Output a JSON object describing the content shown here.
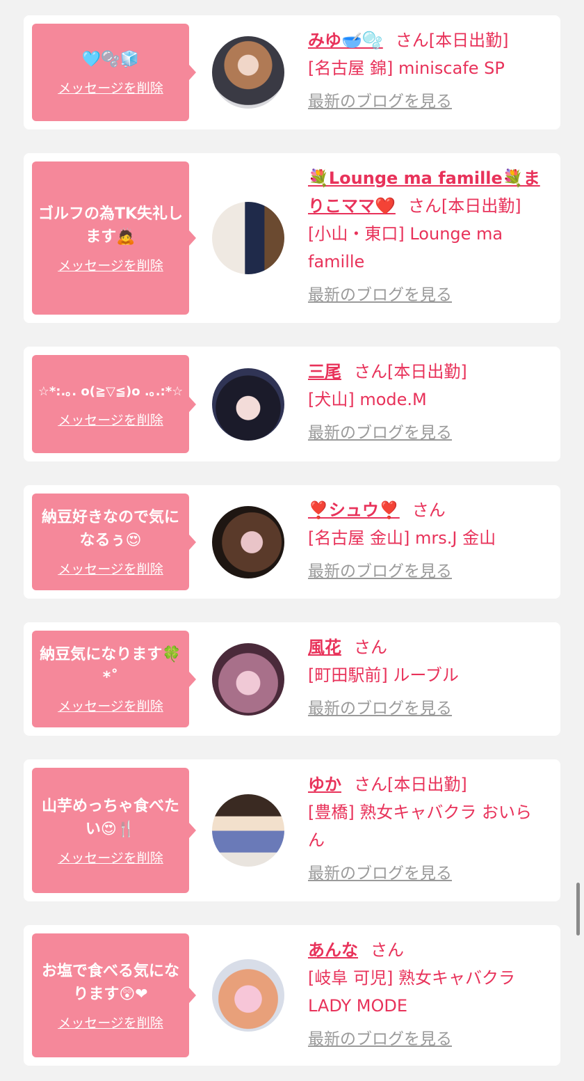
{
  "delete_label": "メッセージを削除",
  "blog_label": "最新のブログを見る",
  "entries": [
    {
      "message": "🩵🫧🧊",
      "name": "みゆ🥣🫧",
      "suffix": "さん[本日出勤]",
      "shop": "[名古屋 錦] miniscafe SP"
    },
    {
      "message": "ゴルフの為TK失礼します🙇",
      "name": "💐Lounge ma famille💐まりこママ❤️",
      "suffix": "さん[本日出勤]",
      "shop": "[小山・東口] Lounge ma famille"
    },
    {
      "message": "☆*:.｡. o(≧▽≦)o .｡.:*☆",
      "name": "三尾",
      "suffix": "さん[本日出勤]",
      "shop": "[犬山] mode.M"
    },
    {
      "message": "納豆好きなので気になるぅ😍",
      "name": "❣️シュウ❣️",
      "suffix": "さん",
      "shop": "[名古屋 金山] mrs.J 金山"
    },
    {
      "message": "納豆気になります🍀*˚",
      "name": "風花",
      "suffix": "さん",
      "shop": "[町田駅前] ルーブル"
    },
    {
      "message": "山芋めっちゃ食べたい😍🍴",
      "name": "ゆか",
      "suffix": "さん[本日出勤]",
      "shop": "[豊橋] 熟女キャバクラ おいらん"
    },
    {
      "message": "お塩で食べる気になります😲❤",
      "name": "あんな",
      "suffix": "さん",
      "shop": "[岐阜 可児] 熟女キャバクラ LADY MODE"
    }
  ]
}
